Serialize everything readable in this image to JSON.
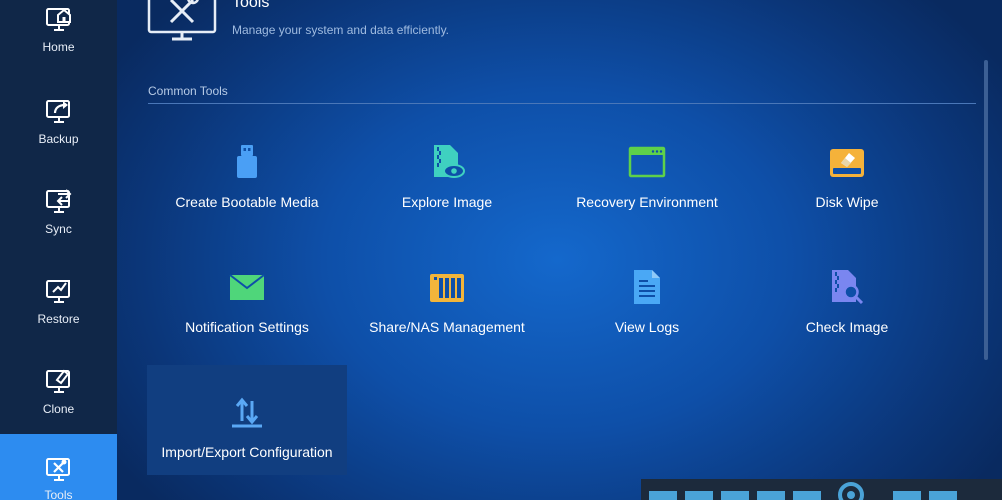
{
  "sidebar": {
    "items": [
      {
        "label": "Home",
        "icon": "home-icon"
      },
      {
        "label": "Backup",
        "icon": "backup-icon"
      },
      {
        "label": "Sync",
        "icon": "sync-icon"
      },
      {
        "label": "Restore",
        "icon": "restore-icon"
      },
      {
        "label": "Clone",
        "icon": "clone-icon"
      },
      {
        "label": "Tools",
        "icon": "tools-icon",
        "active": true
      }
    ]
  },
  "header": {
    "title": "Tools",
    "subtitle": "Manage your system and data efficiently."
  },
  "section": {
    "title": "Common Tools"
  },
  "tools": [
    {
      "label": "Create Bootable Media",
      "icon": "usb-drive-icon",
      "color": "#4a9ff5"
    },
    {
      "label": "Explore Image",
      "icon": "explore-image-icon",
      "color": "#3fd1c0"
    },
    {
      "label": "Recovery Environment",
      "icon": "window-icon",
      "color": "#5ed14a"
    },
    {
      "label": "Disk Wipe",
      "icon": "disk-wipe-icon",
      "color": "#f5b23a"
    },
    {
      "label": "Notification Settings",
      "icon": "envelope-icon",
      "color": "#4fd67a"
    },
    {
      "label": "Share/NAS Management",
      "icon": "nas-icon",
      "color": "#f2b53b"
    },
    {
      "label": "View Logs",
      "icon": "document-icon",
      "color": "#4aa8f5"
    },
    {
      "label": "Check Image",
      "icon": "check-image-icon",
      "color": "#7a86f0"
    },
    {
      "label": "Import/Export Configuration",
      "icon": "import-export-icon",
      "color": "#5aa8f5"
    }
  ]
}
